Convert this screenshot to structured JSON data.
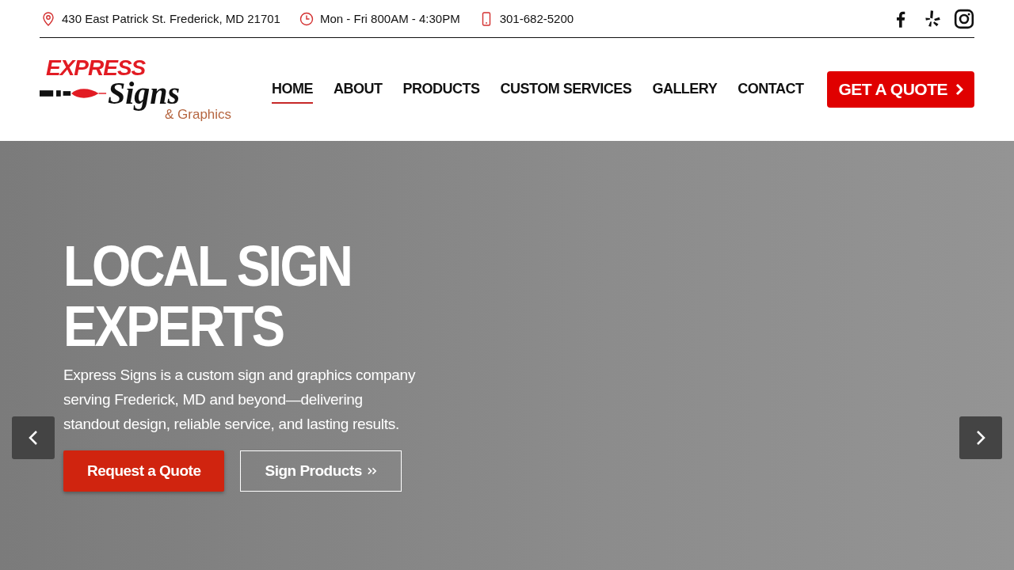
{
  "topbar": {
    "address": "430 East Patrick St. Frederick, MD 21701",
    "hours": "Mon - Fri 800AM - 4:30PM",
    "phone": "301-682-5200"
  },
  "logo": {
    "line_1": "EXPRESS",
    "line_2": "Signs",
    "line_3": "& Graphics"
  },
  "nav": [
    {
      "label": "HOME",
      "selected": true
    },
    {
      "label": "ABOUT",
      "selected": false
    },
    {
      "label": "PRODUCTS",
      "selected": false
    },
    {
      "label": "CUSTOM SERVICES",
      "selected": false
    },
    {
      "label": "GALLERY",
      "selected": false
    },
    {
      "label": "CONTACT",
      "selected": false
    }
  ],
  "quote_button": "GET A QUOTE",
  "hero": {
    "title_lines": [
      "LOCAL SIGN",
      "EXPERTS"
    ],
    "text": "Express Signs is a custom sign and graphics company serving Frederick, MD and beyond—delivering standout design, reliable service, and lasting results.",
    "buttons": [
      {
        "label": "Request a Quote",
        "kind": "primary"
      },
      {
        "label": "Sign Products",
        "kind": "outline"
      }
    ]
  }
}
